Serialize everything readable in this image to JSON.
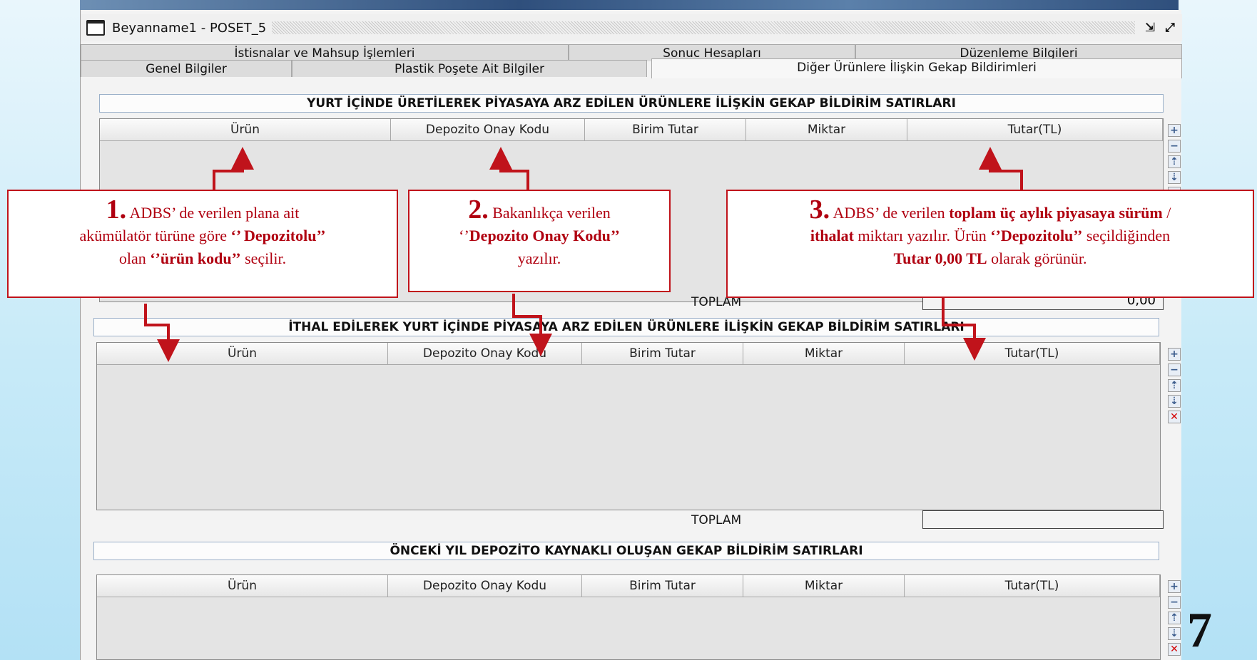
{
  "window": {
    "title": "Beyanname1 - POSET_5",
    "controls": [
      "minimize-icon",
      "maximize-icon"
    ]
  },
  "tabs": {
    "row1": [
      "İstisnalar ve Mahsup İşlemleri",
      "Sonuc Hesapları",
      "Düzenleme Bilgileri"
    ],
    "row2": [
      "Genel Bilgiler",
      "Plastik Poşete Ait Bilgiler",
      "Diğer Ürünlere İlişkin Gekap Bildirimleri"
    ],
    "active": "Diğer Ürünlere İlişkin Gekap Bildirimleri"
  },
  "columns": [
    "Ürün",
    "Depozito Onay Kodu",
    "Birim Tutar",
    "Miktar",
    "Tutar(TL)"
  ],
  "sections": {
    "domestic": {
      "title": "YURT İÇİNDE ÜRETİLEREK PİYASAYA ARZ EDİLEN ÜRÜNLERE İLİŞKİN GEKAP BİLDİRİM SATIRLARI",
      "total_label": "TOPLAM",
      "total_value": "0,00"
    },
    "imported": {
      "title": "İTHAL EDİLEREK YURT İÇİNDE PİYASAYA ARZ EDİLEN ÜRÜNLERE İLİŞKİN GEKAP BİLDİRİM SATIRLARI",
      "total_label": "TOPLAM",
      "total_value": ""
    },
    "previous_year": {
      "title": "ÖNCEKİ YIL DEPOZİTO KAYNAKLI OLUŞAN GEKAP BİLDİRİM SATIRLARI"
    }
  },
  "row_buttons": [
    "add-icon",
    "remove-icon",
    "move-up-icon",
    "move-down-icon",
    "delete-icon"
  ],
  "callouts": {
    "c1": {
      "num": "1.",
      "t1": " ADBS’ de verilen plana ait",
      "t2": "akümülatör türüne göre ",
      "b1": "‘’ Depozitolu’’",
      "t3": "olan ",
      "b2": "‘’ürün kodu’’",
      "t4": " seçilir."
    },
    "c2": {
      "num": "2.",
      "t1": " Bakanlıkça verilen",
      "q1": "‘’",
      "b1": "Depozito Onay Kodu’’",
      "t2": "yazılır."
    },
    "c3": {
      "num": "3.",
      "t1": " ADBS’ de verilen ",
      "b1": "toplam üç aylık piyasaya sürüm",
      "t2": " /",
      "b2": "ithalat",
      "t3": " miktarı yazılır. Ürün ",
      "b3": "‘’Depozitolu’’",
      "t4": " seçildiğinden",
      "b4": "Tutar  0,00 TL",
      "t5": " olarak görünür."
    }
  },
  "page_number": "7"
}
